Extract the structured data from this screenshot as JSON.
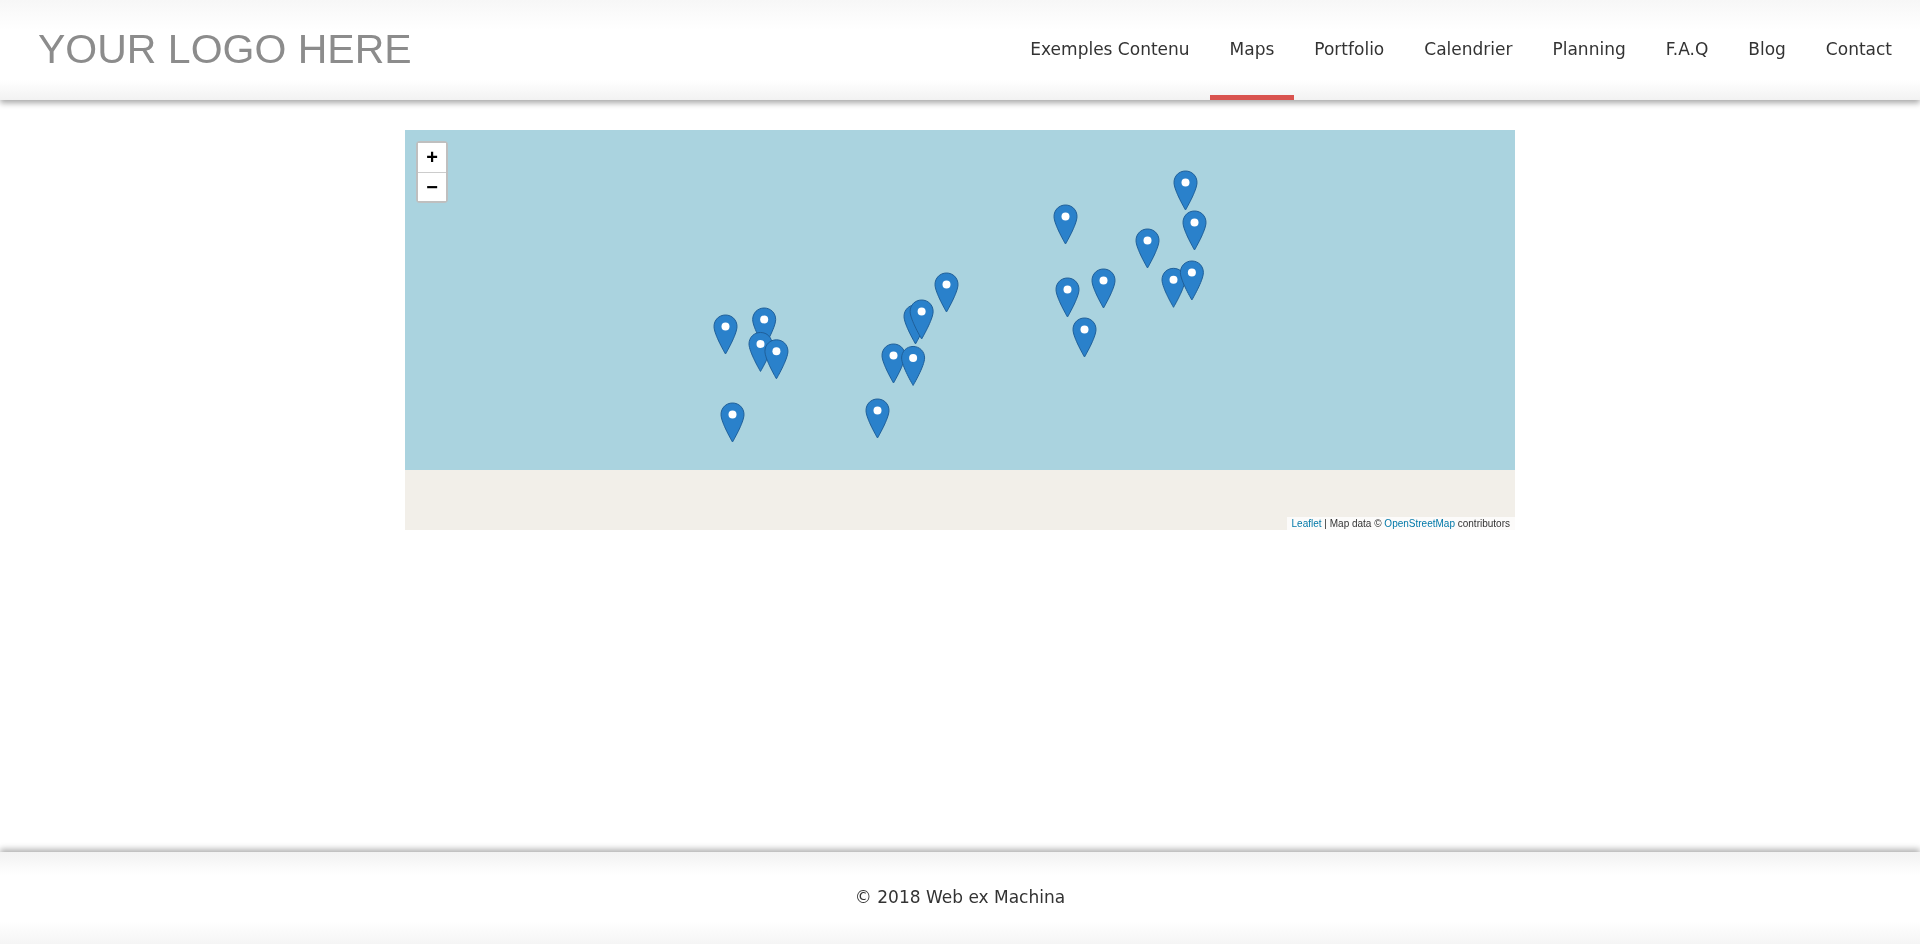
{
  "header": {
    "logo": "YOUR LOGO HERE",
    "nav": [
      {
        "label": "Exemples Contenu",
        "selected": false
      },
      {
        "label": "Maps",
        "selected": true
      },
      {
        "label": "Portfolio",
        "selected": false
      },
      {
        "label": "Calendrier",
        "selected": false
      },
      {
        "label": "Planning",
        "selected": false
      },
      {
        "label": "F.A.Q",
        "selected": false
      },
      {
        "label": "Blog",
        "selected": false
      },
      {
        "label": "Contact",
        "selected": false
      }
    ]
  },
  "map": {
    "zoom_controls": [
      "+",
      "−"
    ],
    "attribution": [
      {
        "kind": "link",
        "text": "Leaflet"
      },
      {
        "kind": "text",
        "text": "| Map data ©"
      },
      {
        "kind": "link",
        "text": "OpenStreetMap"
      },
      {
        "kind": "text",
        "text": "contributors"
      }
    ]
  },
  "footer": {
    "text": "© 2018 Web ex Machina"
  }
}
